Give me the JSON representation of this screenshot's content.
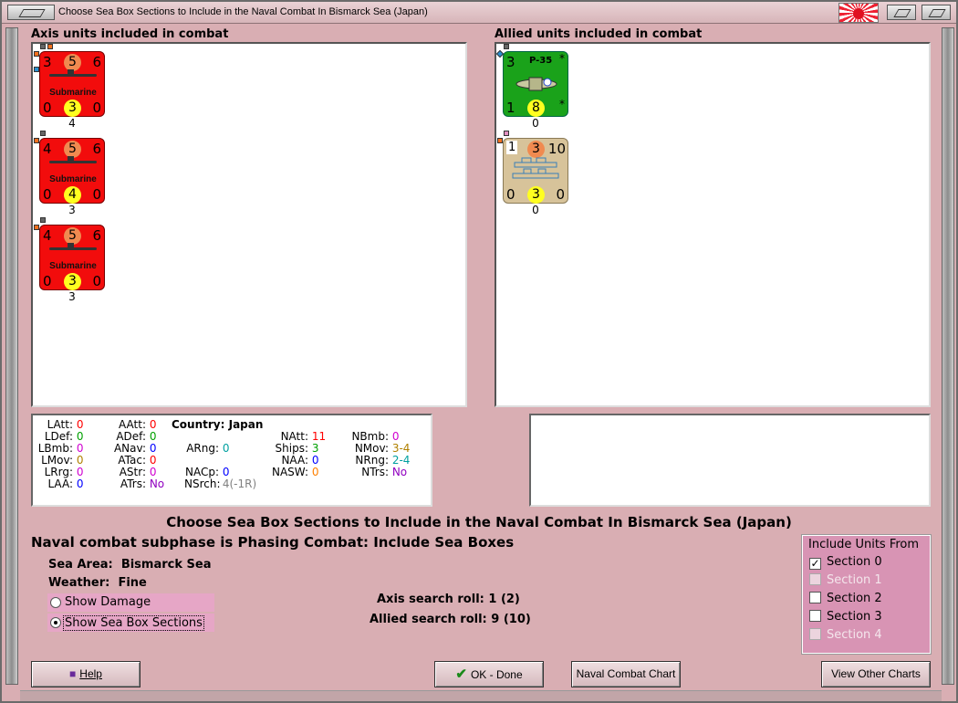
{
  "window": {
    "title": "Choose Sea Box Sections to Include in the Naval Combat In Bismarck Sea (Japan)"
  },
  "axis": {
    "label": "Axis units included in combat",
    "units": [
      {
        "top_left": "3",
        "center": "5",
        "top_right": "6",
        "name": "Submarine",
        "bot_left": "0",
        "bot_center": "3",
        "bot_right": "0",
        "count": "4"
      },
      {
        "top_left": "4",
        "center": "5",
        "top_right": "6",
        "name": "Submarine",
        "bot_left": "0",
        "bot_center": "4",
        "bot_right": "0",
        "count": "3"
      },
      {
        "top_left": "4",
        "center": "5",
        "top_right": "6",
        "name": "Submarine",
        "bot_left": "0",
        "bot_center": "3",
        "bot_right": "0",
        "count": "3"
      }
    ]
  },
  "allied": {
    "label": "Allied units included in combat",
    "units": [
      {
        "top_left": "3",
        "name": "P-35",
        "top_right": "*",
        "bot_left": "1",
        "bot_center": "8",
        "bot_right": "*",
        "count": "0"
      },
      {
        "top_left": "1",
        "center": "3",
        "top_right": "10",
        "bot_left": "0",
        "bot_center": "3",
        "bot_right": "0",
        "count": "0"
      }
    ]
  },
  "stats": {
    "latt": {
      "k": "LAtt:",
      "v": "0"
    },
    "ldef": {
      "k": "LDef:",
      "v": "0"
    },
    "lbmb": {
      "k": "LBmb:",
      "v": "0"
    },
    "lmov": {
      "k": "LMov:",
      "v": "0"
    },
    "lrrg": {
      "k": "LRrg:",
      "v": "0"
    },
    "laa": {
      "k": "LAA:",
      "v": "0"
    },
    "aatt": {
      "k": "AAtt:",
      "v": "0"
    },
    "adef": {
      "k": "ADef:",
      "v": "0"
    },
    "anav": {
      "k": "ANav:",
      "v": "0"
    },
    "atac": {
      "k": "ATac:",
      "v": "0"
    },
    "astr": {
      "k": "AStr:",
      "v": "0"
    },
    "atrs": {
      "k": "ATrs:",
      "v": "No"
    },
    "country": {
      "k": "Country:",
      "v": "Japan"
    },
    "arng": {
      "k": "ARng:",
      "v": "0"
    },
    "nacp": {
      "k": "NACp:",
      "v": "0"
    },
    "nsrch": {
      "k": "NSrch:",
      "v": "4(-1R)"
    },
    "natt": {
      "k": "NAtt:",
      "v": "11"
    },
    "ships": {
      "k": "Ships:",
      "v": "3"
    },
    "naa": {
      "k": "NAA:",
      "v": "0"
    },
    "nasw": {
      "k": "NASW:",
      "v": "0"
    },
    "nbmb": {
      "k": "NBmb:",
      "v": "0"
    },
    "nmov": {
      "k": "NMov:",
      "v": "3-4"
    },
    "nrng": {
      "k": "NRng:",
      "v": "2-4"
    },
    "ntrs": {
      "k": "NTrs:",
      "v": "No"
    }
  },
  "colors": {
    "red": "#ff0000",
    "green": "#00a000",
    "magenta": "#d000d0",
    "olive": "#b08000",
    "blue": "#0000ff",
    "teal": "#00a0a0",
    "orange": "#ff8000",
    "purple": "#9000c0",
    "gray": "#808080"
  },
  "main": {
    "heading": "Choose Sea Box Sections to Include in the Naval Combat In Bismarck Sea (Japan)",
    "subphase": "Naval combat subphase is Phasing Combat: Include Sea Boxes",
    "sea_area_label": "Sea Area:",
    "sea_area": "Bismarck Sea",
    "weather_label": "Weather:",
    "weather": "Fine",
    "show_damage": "Show Damage",
    "show_sections": "Show Sea Box Sections",
    "axis_roll": "Axis search roll: 1 (2)",
    "allied_roll": "Allied search roll: 9 (10)"
  },
  "include": {
    "title": "Include Units From",
    "sections": [
      {
        "label": "Section 0",
        "checked": true,
        "enabled": true
      },
      {
        "label": "Section 1",
        "checked": false,
        "enabled": false
      },
      {
        "label": "Section 2",
        "checked": false,
        "enabled": true
      },
      {
        "label": "Section 3",
        "checked": false,
        "enabled": true
      },
      {
        "label": "Section 4",
        "checked": false,
        "enabled": false
      }
    ]
  },
  "buttons": {
    "help": "Help",
    "ok": "OK - Done",
    "chart": "Naval Combat Chart",
    "other": "View Other Charts"
  }
}
